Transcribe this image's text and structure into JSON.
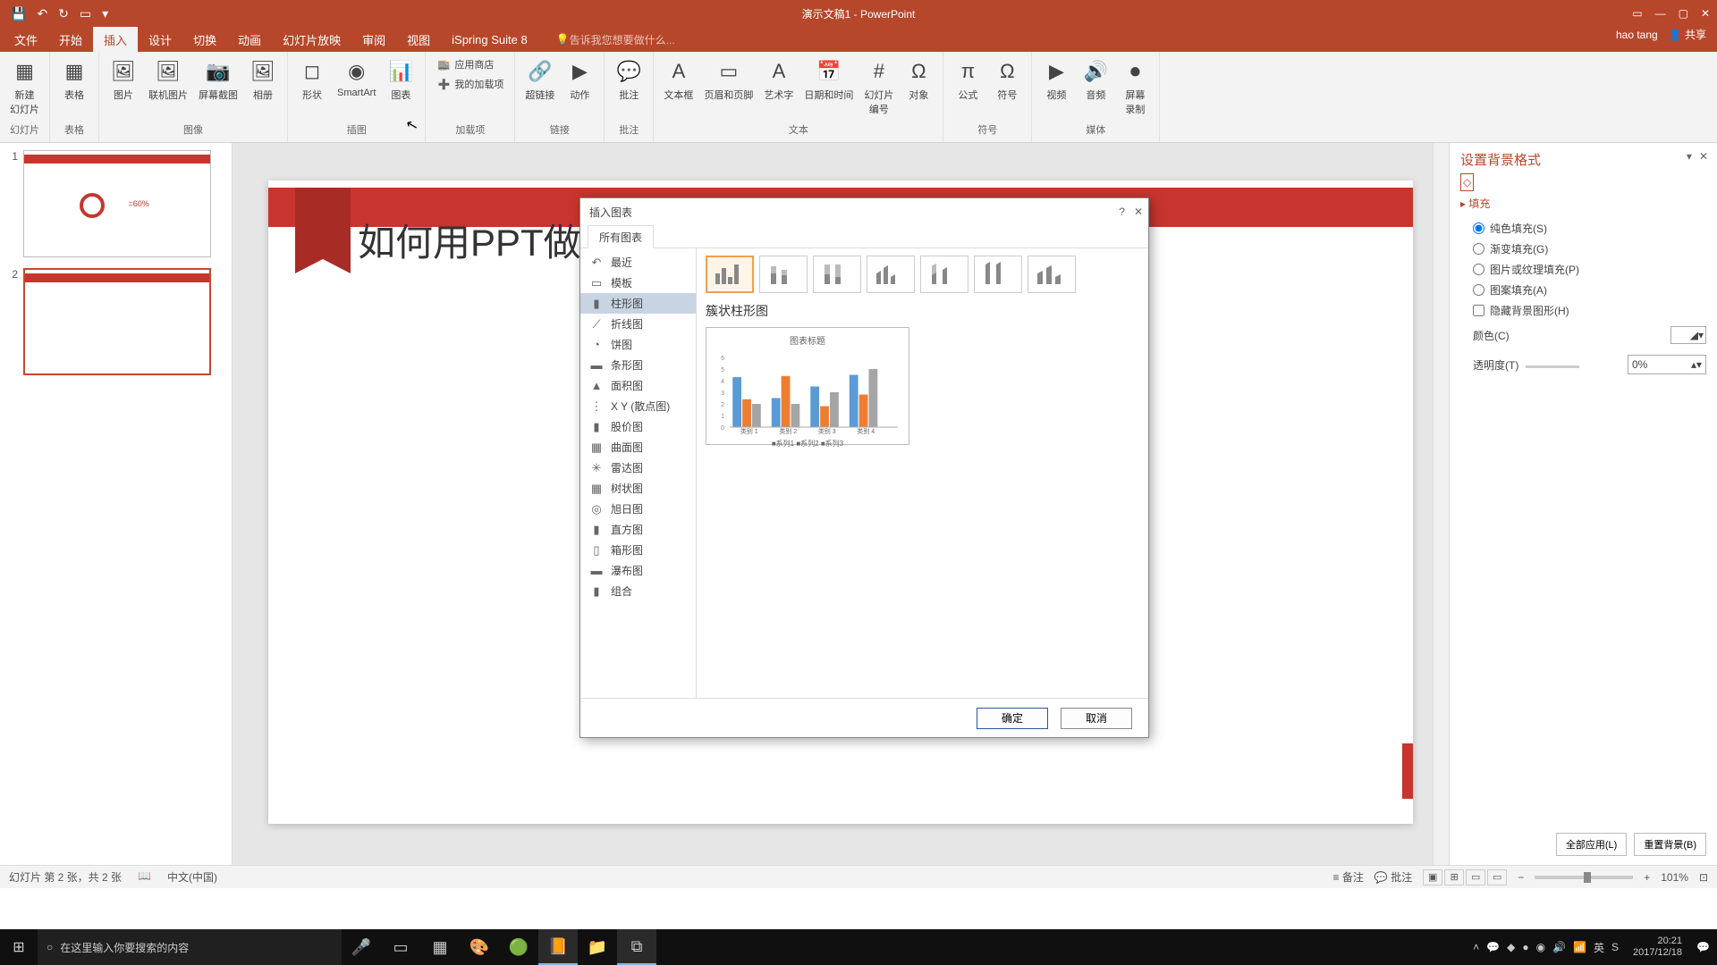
{
  "titlebar": {
    "title": "演示文稿1 - PowerPoint"
  },
  "menubar": {
    "tabs": [
      "文件",
      "开始",
      "插入",
      "设计",
      "切换",
      "动画",
      "幻灯片放映",
      "审阅",
      "视图",
      "iSpring Suite 8"
    ],
    "active_index": 2,
    "tellme_placeholder": "告诉我您想要做什么...",
    "user": "hao tang",
    "share": "共享"
  },
  "ribbon": {
    "groups": [
      {
        "label": "幻灯片",
        "items": [
          {
            "icon": "▦",
            "label": "新建\n幻灯片"
          }
        ]
      },
      {
        "label": "表格",
        "items": [
          {
            "icon": "▦",
            "label": "表格"
          }
        ]
      },
      {
        "label": "图像",
        "items": [
          {
            "icon": "🖼",
            "label": "图片"
          },
          {
            "icon": "🖼",
            "label": "联机图片"
          },
          {
            "icon": "📷",
            "label": "屏幕截图"
          },
          {
            "icon": "🖼",
            "label": "相册"
          }
        ]
      },
      {
        "label": "插图",
        "items": [
          {
            "icon": "◻",
            "label": "形状"
          },
          {
            "icon": "◉",
            "label": "SmartArt"
          },
          {
            "icon": "📊",
            "label": "图表"
          }
        ]
      },
      {
        "label": "加载项",
        "small": true,
        "items": [
          {
            "icon": "🏬",
            "label": "应用商店"
          },
          {
            "icon": "➕",
            "label": "我的加载项"
          }
        ]
      },
      {
        "label": "链接",
        "items": [
          {
            "icon": "🔗",
            "label": "超链接"
          },
          {
            "icon": "▶",
            "label": "动作"
          }
        ]
      },
      {
        "label": "批注",
        "items": [
          {
            "icon": "💬",
            "label": "批注"
          }
        ]
      },
      {
        "label": "文本",
        "items": [
          {
            "icon": "A",
            "label": "文本框"
          },
          {
            "icon": "▭",
            "label": "页眉和页脚"
          },
          {
            "icon": "A",
            "label": "艺术字"
          },
          {
            "icon": "📅",
            "label": "日期和时间"
          },
          {
            "icon": "#",
            "label": "幻灯片\n编号"
          },
          {
            "icon": "Ω",
            "label": "对象"
          }
        ]
      },
      {
        "label": "符号",
        "items": [
          {
            "icon": "π",
            "label": "公式"
          },
          {
            "icon": "Ω",
            "label": "符号"
          }
        ]
      },
      {
        "label": "媒体",
        "items": [
          {
            "icon": "▶",
            "label": "视频"
          },
          {
            "icon": "🔊",
            "label": "音频"
          },
          {
            "icon": "⏺",
            "label": "屏幕\n录制"
          }
        ]
      }
    ]
  },
  "slides": {
    "items": [
      {
        "num": "1",
        "accent": "=60%"
      },
      {
        "num": "2"
      }
    ],
    "active_index": 1
  },
  "slide": {
    "title": "如何用PPT做数据图"
  },
  "format_pane": {
    "title": "设置背景格式",
    "section": "填充",
    "options": [
      "纯色填充(S)",
      "渐变填充(G)",
      "图片或纹理填充(P)",
      "图案填充(A)"
    ],
    "hide_bg": "隐藏背景图形(H)",
    "color_label": "颜色(C)",
    "transparency_label": "透明度(T)",
    "transparency_value": "0%",
    "apply_all": "全部应用(L)",
    "reset_bg": "重置背景(B)"
  },
  "statusbar": {
    "slide_info": "幻灯片 第 2 张，共 2 张",
    "lang": "中文(中国)",
    "notes": "备注",
    "comments": "批注",
    "zoom": "101%"
  },
  "taskbar": {
    "search_placeholder": "在这里输入你要搜索的内容",
    "time": "20:21",
    "date": "2017/12/18"
  },
  "dialog": {
    "title": "插入图表",
    "tab": "所有图表",
    "categories": [
      {
        "icon": "↶",
        "label": "最近"
      },
      {
        "icon": "▭",
        "label": "模板"
      },
      {
        "icon": "▮",
        "label": "柱形图"
      },
      {
        "icon": "⟋",
        "label": "折线图"
      },
      {
        "icon": "◔",
        "label": "饼图"
      },
      {
        "icon": "▬",
        "label": "条形图"
      },
      {
        "icon": "▲",
        "label": "面积图"
      },
      {
        "icon": "⋮",
        "label": "X Y (散点图)"
      },
      {
        "icon": "▮",
        "label": "股价图"
      },
      {
        "icon": "▦",
        "label": "曲面图"
      },
      {
        "icon": "✳",
        "label": "雷达图"
      },
      {
        "icon": "▦",
        "label": "树状图"
      },
      {
        "icon": "◎",
        "label": "旭日图"
      },
      {
        "icon": "▮",
        "label": "直方图"
      },
      {
        "icon": "▯",
        "label": "箱形图"
      },
      {
        "icon": "▬",
        "label": "瀑布图"
      },
      {
        "icon": "▮",
        "label": "组合"
      }
    ],
    "selected_cat_index": 2,
    "selected_subtype_name": "簇状柱形图",
    "preview_title": "图表标题",
    "preview_categories": [
      "类别 1",
      "类别 2",
      "类别 3",
      "类别 4"
    ],
    "preview_legend": "■系列1 ■系列2 ■系列3",
    "ok": "确定",
    "cancel": "取消"
  },
  "chart_data": {
    "type": "bar",
    "title": "图表标题",
    "categories": [
      "类别 1",
      "类别 2",
      "类别 3",
      "类别 4"
    ],
    "series": [
      {
        "name": "系列1",
        "values": [
          4.3,
          2.5,
          3.5,
          4.5
        ],
        "color": "#5b9bd5"
      },
      {
        "name": "系列2",
        "values": [
          2.4,
          4.4,
          1.8,
          2.8
        ],
        "color": "#ed7d31"
      },
      {
        "name": "系列3",
        "values": [
          2.0,
          2.0,
          3.0,
          5.0
        ],
        "color": "#a5a5a5"
      }
    ],
    "ylim": [
      0,
      6
    ],
    "xlabel": "",
    "ylabel": ""
  }
}
